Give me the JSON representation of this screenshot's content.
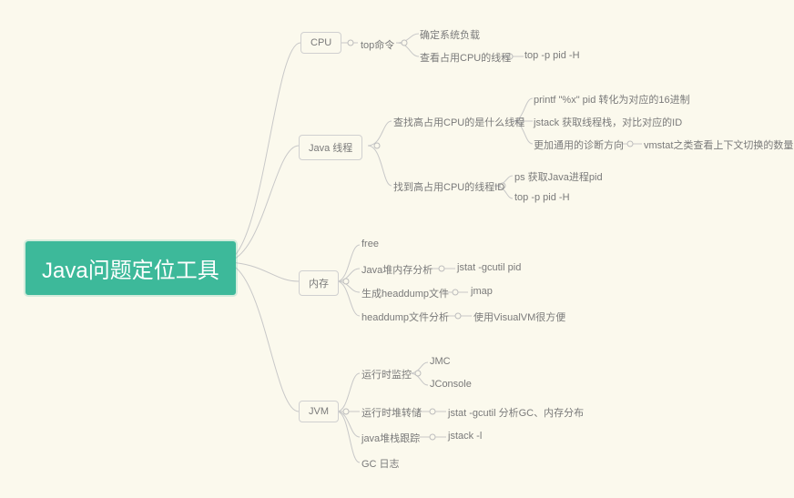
{
  "root": "Java问题定位工具",
  "cpu": {
    "label": "CPU",
    "top_cmd": "top命令",
    "load": "确定系统负载",
    "threads": "查看占用CPU的线程",
    "threads_cmd": "top -p pid -H"
  },
  "java_thread": {
    "label": "Java 线程",
    "find_thread": "查找高占用CPU的是什么线程",
    "printf": "printf \"%x\" pid 转化为对应的16进制",
    "jstack": "jstack 获取线程栈，对比对应的ID",
    "more_general": "更加通用的诊断方向",
    "vmstat": "vmstat之类查看上下文切换的数量",
    "find_tid": "找到高占用CPU的线程ID",
    "ps": "ps 获取Java进程pid",
    "top_cmd": "top -p pid -H"
  },
  "memory": {
    "label": "内存",
    "free": "free",
    "heap_analysis": "Java堆内存分析",
    "jstat": "jstat -gcutil pid",
    "gen_headdump": "生成headdump文件",
    "jmap": "jmap",
    "headdump_analysis": "headdump文件分析",
    "visualvm": "使用VisualVM很方便"
  },
  "jvm": {
    "label": "JVM",
    "runtime_monitor": "运行时监控",
    "jmc": "JMC",
    "jconsole": "JConsole",
    "runtime_dump": "运行时堆转储",
    "jstat": "jstat -gcutil 分析GC、内存分布",
    "stack_trace": "java堆栈跟踪",
    "jstack": "jstack -l",
    "gc_log": "GC 日志"
  }
}
